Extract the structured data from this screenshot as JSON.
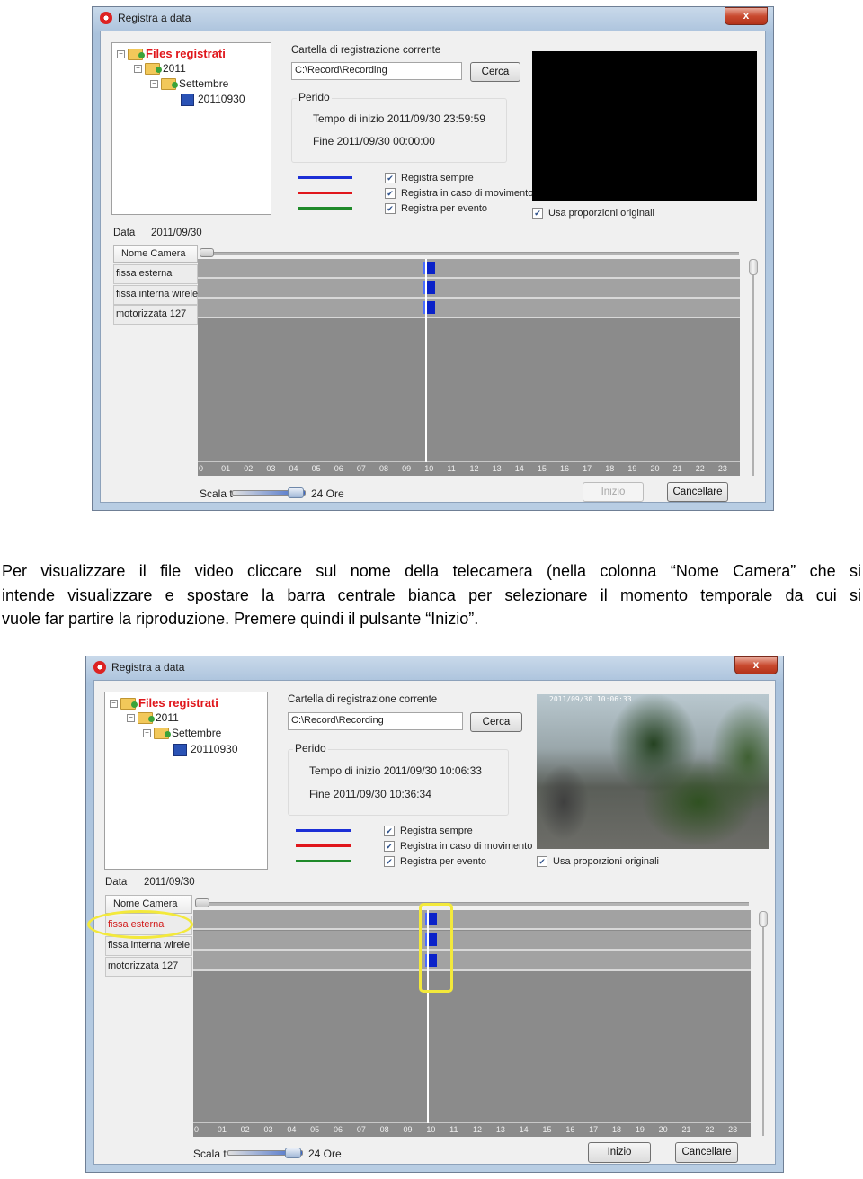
{
  "windows": [
    {
      "title": "Registra a data",
      "close_glyph": "x",
      "tree": {
        "root": "Files registrati",
        "year": "2011",
        "month": "Settembre",
        "day": "20110930"
      },
      "folder_label": "Cartella di registrazione corrente",
      "folder_path": "C:\\Record\\Recording",
      "browse_button": "Cerca",
      "period_title": "Perido",
      "start_time": "Tempo di inizio 2011/09/30 23:59:59",
      "end_time": "Fine 2011/09/30 00:00:00",
      "legend": [
        {
          "color": "#1c2fd6",
          "label": "Registra sempre"
        },
        {
          "color": "#e0161b",
          "label": "Registra in caso di movimento"
        },
        {
          "color": "#1f8a2a",
          "label": "Registra per evento"
        }
      ],
      "keep_ratio": "Usa  proporzioni originali",
      "date_label": "Data",
      "date_value": "2011/09/30",
      "camera_header": "Nome Camera",
      "cameras": [
        "fissa esterna",
        "fissa interna wirele",
        "motorizzata 127"
      ],
      "scale_label": "Scala t",
      "scale_value": "24 Ore",
      "start_button": "Inizio",
      "start_enabled": false,
      "cancel_button": "Cancellare",
      "video": "black",
      "video_timestamp": ""
    },
    {
      "title": "Registra a data",
      "close_glyph": "x",
      "tree": {
        "root": "Files registrati",
        "year": "2011",
        "month": "Settembre",
        "day": "20110930"
      },
      "folder_label": "Cartella di registrazione corrente",
      "folder_path": "C:\\Record\\Recording",
      "browse_button": "Cerca",
      "period_title": "Perido",
      "start_time": "Tempo di inizio 2011/09/30 10:06:33",
      "end_time": "Fine 2011/09/30 10:36:34",
      "legend": [
        {
          "color": "#1c2fd6",
          "label": "Registra sempre"
        },
        {
          "color": "#e0161b",
          "label": "Registra in caso di movimento"
        },
        {
          "color": "#1f8a2a",
          "label": "Registra per evento"
        }
      ],
      "keep_ratio": "Usa  proporzioni originali",
      "date_label": "Data",
      "date_value": "2011/09/30",
      "camera_header": "Nome Camera",
      "cameras": [
        "fissa esterna",
        "fissa interna wirele",
        "motorizzata 127"
      ],
      "scale_label": "Scala t",
      "scale_value": "24 Ore",
      "start_button": "Inizio",
      "start_enabled": true,
      "cancel_button": "Cancellare",
      "video": "camera-image",
      "video_timestamp": "2011/09/30 10:06:33"
    }
  ],
  "hours": [
    "0",
    "01",
    "02",
    "03",
    "04",
    "05",
    "06",
    "07",
    "08",
    "09",
    "10",
    "11",
    "12",
    "13",
    "14",
    "15",
    "16",
    "17",
    "18",
    "19",
    "20",
    "21",
    "22",
    "23"
  ],
  "recording_hour_fraction": 0.42,
  "instructions": [
    "Per visualizzare il file video cliccare sul nome della telecamera (nella colonna “Nome Camera” che si",
    "intende visualizzare e spostare la barra centrale bianca per selezionare il momento temporale da cui si",
    "vuole far partire la riproduzione. Premere quindi il pulsante “Inizio”."
  ],
  "highlight_color": "#f3e93b"
}
